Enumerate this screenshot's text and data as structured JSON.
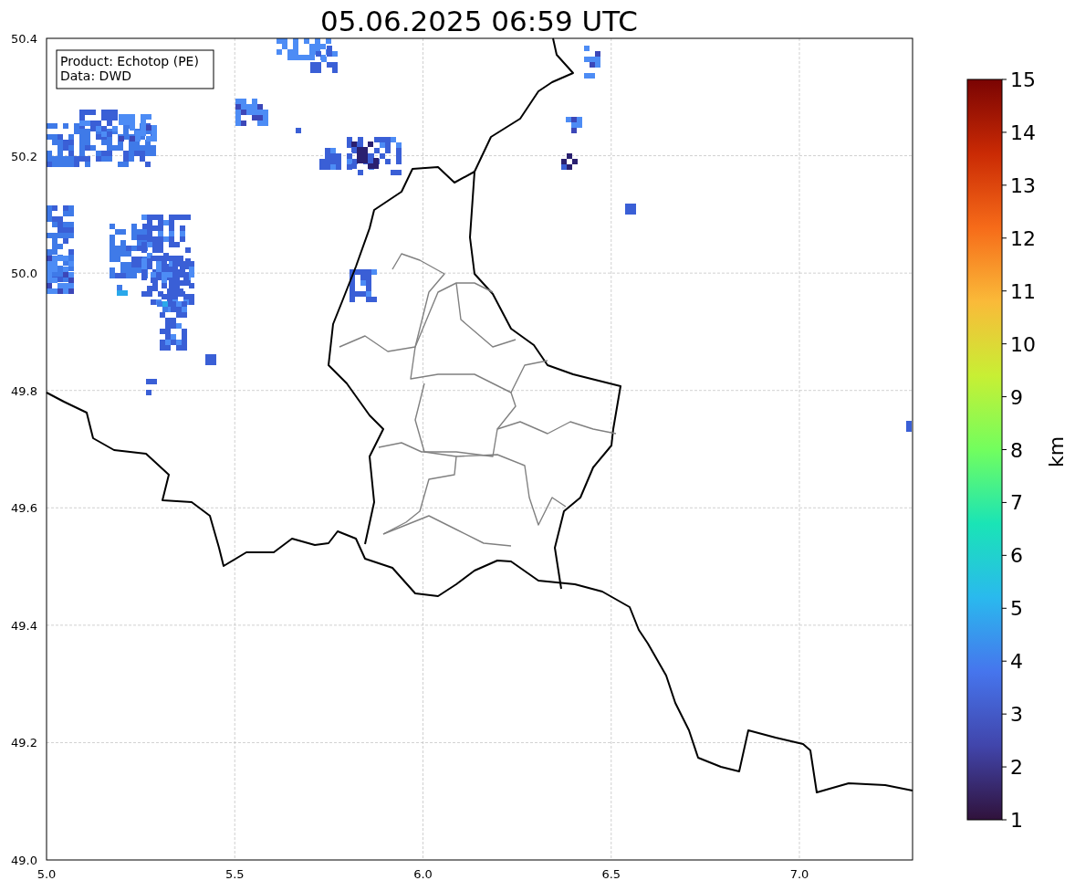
{
  "title": "05.06.2025 06:59 UTC",
  "map": {
    "legend": [
      "Product: Echotop (PE)",
      "Data: DWD"
    ],
    "xticks": [
      "5.0",
      "5.5",
      "6.0",
      "6.5",
      "7.0"
    ],
    "yticks": [
      "50.4",
      "50.2",
      "50.0",
      "49.8",
      "49.6",
      "49.4",
      "49.2",
      "49.0"
    ]
  },
  "colorbar": {
    "label": "km",
    "ticks": [
      "15",
      "14",
      "13",
      "12",
      "11",
      "10",
      "9",
      "8",
      "7",
      "6",
      "5",
      "4",
      "3",
      "2",
      "1"
    ]
  }
}
